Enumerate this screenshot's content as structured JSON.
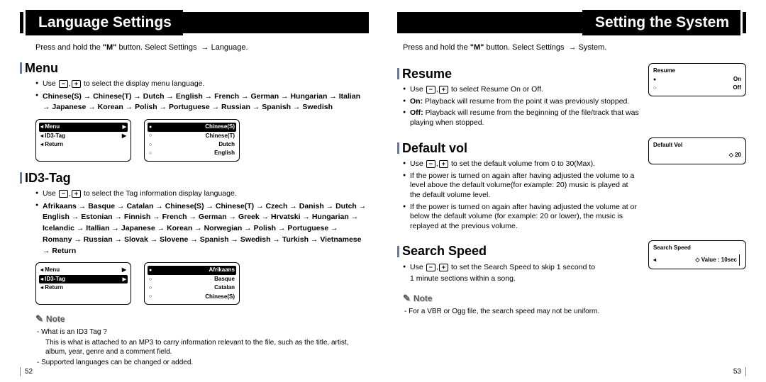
{
  "left": {
    "header": "Language Settings",
    "intro_a": "Press and hold the ",
    "intro_b": "\"M\"",
    "intro_c": " button. Select Settings ",
    "intro_d": "Language.",
    "menu": {
      "title": "Menu",
      "use_text_a": "Use ",
      "use_text_b": " to select the display menu language.",
      "langs": "Chinese(S)  → Chinese(T)  → Dutch  →  English  → French  → German  → Hungarian  → Italian  → Japanese  → Korean  → Polish  → Portuguese  → Russian  → Spanish  → Swedish",
      "screen1": {
        "r1": "Menu",
        "r2": "ID3-Tag",
        "r3": "Return"
      },
      "screen2": {
        "r1": "Chinese(S)",
        "r2": "Chinese(T)",
        "r3": "Dutch",
        "r4": "English"
      }
    },
    "id3": {
      "title": "ID3-Tag",
      "use_text_a": "Use ",
      "use_text_b": " to select the Tag information display language.",
      "langs": "Afrikaans  → Basque  → Catalan  → Chinese(S)  → Chinese(T)  → Czech  → Danish  → Dutch  → English  → Estonian  → Finnish  → French  → German  → Greek  → Hrvatski  → Hungarian  → Icelandic  → Itallian  → Japanese  → Korean  → Norwegian  → Polish  → Portuguese  → Romany  → Russian  → Slovak  → Slovene  → Spanish  → Swedish  → Turkish  → Vietnamese  → Return",
      "screen1": {
        "r1": "Menu",
        "r2": "ID3-Tag",
        "r3": "Return"
      },
      "screen2": {
        "r1": "Afrikaans",
        "r2": "Basque",
        "r3": "Catalan",
        "r4": "Chinese(S)"
      }
    },
    "note": {
      "head": "Note",
      "l1": "- What is an ID3 Tag ?",
      "l2": "This is what is attached to an MP3 to carry information relevant to the file, such as the title, artist, album, year, genre and a comment field.",
      "l3": "- Supported languages can be changed or added."
    },
    "pagenum": "52"
  },
  "right": {
    "header": "Setting the System",
    "intro_a": "Press and hold the ",
    "intro_b": "\"M\"",
    "intro_c": " button. Select Settings ",
    "intro_d": "System.",
    "resume": {
      "title": "Resume",
      "b1a": "Use ",
      "b1b": " to select Resume On or Off.",
      "b2a": "On:",
      "b2b": " Playback will resume from the point it was previously stopped.",
      "b3a": "Off:",
      "b3b": " Playback will resume from the beginning of the file/track that was playing when stopped.",
      "screen": {
        "title": "Resume",
        "r1": "On",
        "r2": "Off"
      }
    },
    "defvol": {
      "title": "Default vol",
      "b1a": "Use ",
      "b1b": " to set the default volume from 0 to 30(Max).",
      "b2": "If the power is turned on again after having adjusted the volume to a level above the default volume(for example: 20) music is played at the default volume level.",
      "b3": "If the power is turned on again after having adjusted the volume at or below the default volume (for example: 20 or lower), the music is replayed at the previous volume.",
      "screen": {
        "title": "Default Vol",
        "val": "20",
        "icon": "◇"
      }
    },
    "search": {
      "title": "Search Speed",
      "b1a": "Use ",
      "b1b": " to set the Search Speed to skip 1 second to",
      "b2": "1 minute sections within a song.",
      "screen": {
        "title": "Search Speed",
        "val": "Value : 10sec",
        "icon": "◇"
      }
    },
    "note": {
      "head": "Note",
      "l1": "- For a VBR or Ogg file, the search speed may not be uniform."
    },
    "pagenum": "53"
  }
}
